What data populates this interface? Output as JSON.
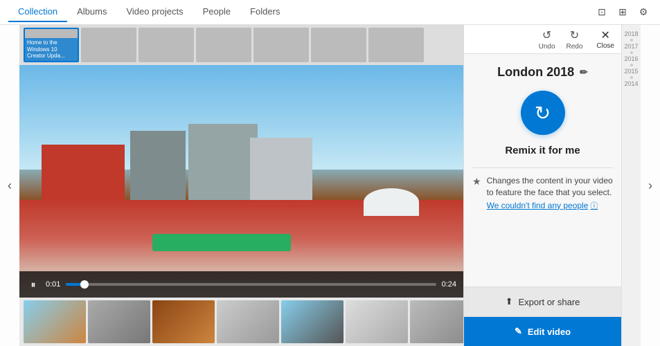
{
  "nav": {
    "tabs": [
      {
        "id": "collection",
        "label": "Collection",
        "active": true
      },
      {
        "id": "albums",
        "label": "Albums",
        "active": false
      },
      {
        "id": "video-projects",
        "label": "Video projects",
        "active": false
      },
      {
        "id": "people",
        "label": "People",
        "active": false
      },
      {
        "id": "folders",
        "label": "Folders",
        "active": false
      }
    ]
  },
  "strip": {
    "banner_label": "Home to the Windows 10 Creator Upda..."
  },
  "video": {
    "current_time": "0:01",
    "total_time": "0:24"
  },
  "panel": {
    "undo_label": "Undo",
    "redo_label": "Redo",
    "close_label": "Close",
    "title": "London 2018",
    "remix_label": "Remix it for me",
    "info_text": "Changes the content in your video to feature the face that you select.",
    "find_people_text": "We couldn't find any people",
    "export_label": "Export or share",
    "edit_video_label": "Edit video"
  },
  "years": [
    "2018",
    "2017",
    "2016",
    "2015",
    "2014"
  ]
}
